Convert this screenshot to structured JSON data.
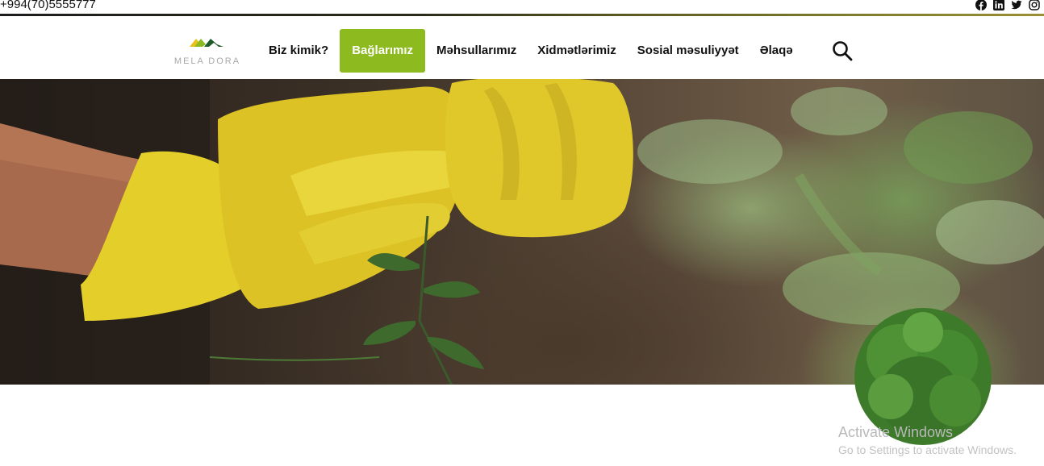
{
  "topbar": {
    "phone": "+994(70)5555777",
    "socials": [
      "facebook-icon",
      "linkedin-icon",
      "twitter-icon",
      "instagram-icon"
    ]
  },
  "brand": {
    "logo_text": "MELA DORA",
    "accent": "#8cba1f"
  },
  "nav": {
    "items": [
      {
        "label": "Biz kimik?",
        "active": false
      },
      {
        "label": "Bağlarımız",
        "active": true
      },
      {
        "label": "Məhsullarımız",
        "active": false
      },
      {
        "label": "Xidmətlərimiz",
        "active": false
      },
      {
        "label": "Sosial məsuliyyət",
        "active": false
      },
      {
        "label": "Əlaqə",
        "active": false
      }
    ],
    "search_icon": "search-icon"
  },
  "hero": {
    "image": "gloved-hands-holding-plant"
  },
  "watermark": {
    "title": "Activate Windows",
    "subtitle": "Go to Settings to activate Windows."
  }
}
